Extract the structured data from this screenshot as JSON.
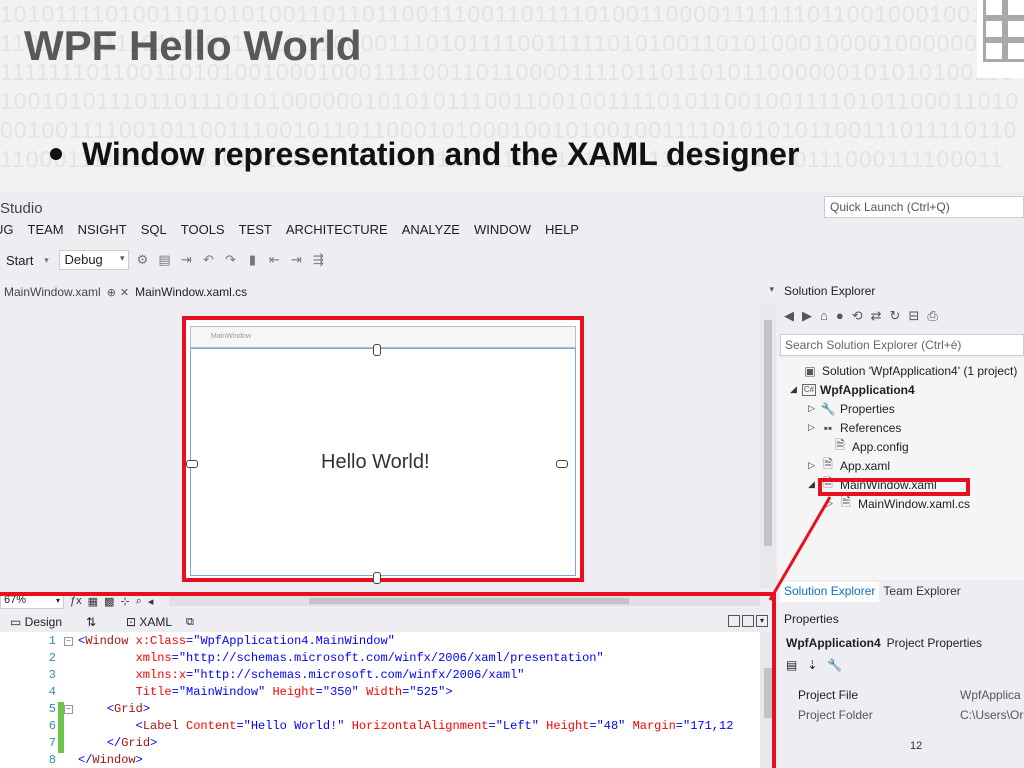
{
  "slide": {
    "title": "WPF Hello World",
    "bullet": "Window representation and the XAML designer",
    "page_number": "12",
    "binary_rows": [
      "1010111101001101010100110110110011100110111101001100001111111011001000100101",
      "1101111011101111011101111100001110101111001111101010011010100010000100000001",
      "1111111011001101010010001000111100110110000111101101101011000000101010100110",
      "1001010111011011101010000001010101110011001001111010110010011110101100011010",
      "0010011110010110011100101101100010100010010100100111101010101100111011110110",
      "1100011111110010101011101101011001100110011011100111000111000111000111100011"
    ]
  },
  "vs": {
    "window_title": "Studio",
    "quick_launch_placeholder": "Quick Launch (Ctrl+Q)",
    "menu": [
      "UG",
      "TEAM",
      "NSIGHT",
      "SQL",
      "TOOLS",
      "TEST",
      "ARCHITECTURE",
      "ANALYZE",
      "WINDOW",
      "HELP"
    ],
    "toolbar": {
      "start": "Start",
      "configuration": "Debug"
    },
    "doc_tabs": {
      "inactive": "MainWindow.xaml",
      "pin": "⊕",
      "close": "✕",
      "active": "MainWindow.xaml.cs"
    },
    "designer": {
      "window_caption": "MainWindow",
      "label_text": "Hello World!",
      "zoom": "67%"
    },
    "split": {
      "design": "Design",
      "swap": "⇅",
      "xaml": "XAML"
    },
    "code_lines": [
      {
        "n": "1",
        "fold": "−",
        "html": "<Window x:Class=\"WpfApplication4.MainWindow\"",
        "changed": false
      },
      {
        "n": "2",
        "fold": "",
        "html": "        xmlns=\"http://schemas.microsoft.com/winfx/2006/xaml/presentation\"",
        "changed": false
      },
      {
        "n": "3",
        "fold": "",
        "html": "        xmlns:x=\"http://schemas.microsoft.com/winfx/2006/xaml\"",
        "changed": false
      },
      {
        "n": "4",
        "fold": "",
        "html": "        Title=\"MainWindow\" Height=\"350\" Width=\"525\">",
        "changed": false
      },
      {
        "n": "5",
        "fold": "−",
        "html": "    <Grid>",
        "changed": true
      },
      {
        "n": "6",
        "fold": "",
        "html": "        <Label Content=\"Hello World!\" HorizontalAlignment=\"Left\" Height=\"48\" Margin=\"171,12",
        "changed": true
      },
      {
        "n": "7",
        "fold": "",
        "html": "    </Grid>",
        "changed": true
      },
      {
        "n": "8",
        "fold": "",
        "html": "</Window>",
        "changed": false
      }
    ]
  },
  "solution_explorer": {
    "title": "Solution Explorer",
    "search_placeholder": "Search Solution Explorer (Ctrl+é)",
    "tree": [
      {
        "label": "Solution 'WpfApplication4' (1 project)",
        "indent": 12,
        "exp": "",
        "icon": "solution-icon",
        "glyph": "▣",
        "bold": false
      },
      {
        "label": "WpfApplication4",
        "indent": 12,
        "exp": "◢",
        "icon": "csharp-project-icon",
        "glyph": "C#",
        "bold": true
      },
      {
        "label": "Properties",
        "indent": 30,
        "exp": "▷",
        "icon": "wrench-icon",
        "glyph": "🔧",
        "bold": false
      },
      {
        "label": "References",
        "indent": 30,
        "exp": "▷",
        "icon": "references-icon",
        "glyph": "▪▪",
        "bold": false
      },
      {
        "label": "App.config",
        "indent": 42,
        "exp": "",
        "icon": "config-file-icon",
        "glyph": "🗎",
        "bold": false
      },
      {
        "label": "App.xaml",
        "indent": 30,
        "exp": "▷",
        "icon": "xaml-file-icon",
        "glyph": "🗎",
        "bold": false
      },
      {
        "label": "MainWindow.xaml",
        "indent": 30,
        "exp": "◢",
        "icon": "xaml-file-icon",
        "glyph": "🗎",
        "bold": false
      },
      {
        "label": "MainWindow.xaml.cs",
        "indent": 48,
        "exp": "▷",
        "icon": "cs-file-icon",
        "glyph": "🗎",
        "bold": false
      }
    ],
    "bottom_tabs": [
      "Solution Explorer",
      "Team Explorer"
    ]
  },
  "properties": {
    "title": "Properties",
    "target_name": "WpfApplication4",
    "target_type": "Project Properties",
    "rows": [
      {
        "name": "Project File",
        "value": "WpfApplica"
      },
      {
        "name": "Project Folder",
        "value": "C:\\Users\\Or"
      }
    ]
  },
  "colors": {
    "highlight": "#e8101f",
    "vs_background": "#eeeef2",
    "line_number": "#2b91af"
  }
}
